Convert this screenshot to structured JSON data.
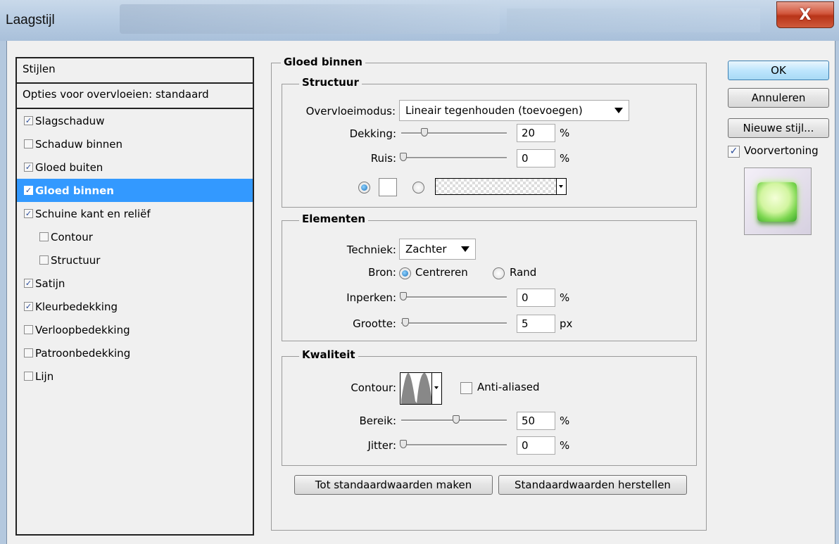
{
  "window": {
    "title": "Laagstijl",
    "close_glyph": "X"
  },
  "styles": {
    "header": "Stijlen",
    "blend_options": "Opties voor overvloeien: standaard",
    "items": [
      {
        "label": "Slagschaduw",
        "checked": true
      },
      {
        "label": "Schaduw binnen",
        "checked": false
      },
      {
        "label": "Gloed buiten",
        "checked": true
      },
      {
        "label": "Gloed binnen",
        "checked": true,
        "selected": true
      },
      {
        "label": "Schuine kant en reliëf",
        "checked": true
      },
      {
        "label": "Contour",
        "checked": false,
        "indent": true
      },
      {
        "label": "Structuur",
        "checked": false,
        "indent": true
      },
      {
        "label": "Satijn",
        "checked": true
      },
      {
        "label": "Kleurbedekking",
        "checked": true
      },
      {
        "label": "Verloopbedekking",
        "checked": false
      },
      {
        "label": "Patroonbedekking",
        "checked": false
      },
      {
        "label": "Lijn",
        "checked": false
      }
    ]
  },
  "panel": {
    "title": "Gloed binnen",
    "structure": {
      "title": "Structuur",
      "blend_mode_label": "Overvloeimodus:",
      "blend_mode_value": "Lineair tegenhouden (toevoegen)",
      "opacity_label": "Dekking:",
      "opacity_value": "20",
      "opacity_unit": "%",
      "opacity_fraction": 0.2,
      "noise_label": "Ruis:",
      "noise_value": "0",
      "noise_unit": "%",
      "noise_fraction": 0.0
    },
    "elements": {
      "title": "Elementen",
      "technique_label": "Techniek:",
      "technique_value": "Zachter",
      "source_label": "Bron:",
      "source_center": "Centreren",
      "source_edge": "Rand",
      "choke_label": "Inperken:",
      "choke_value": "0",
      "choke_unit": "%",
      "choke_fraction": 0.0,
      "size_label": "Grootte:",
      "size_value": "5",
      "size_unit": "px",
      "size_fraction": 0.02
    },
    "quality": {
      "title": "Kwaliteit",
      "contour_label": "Contour:",
      "antialias_label": "Anti-aliased",
      "range_label": "Bereik:",
      "range_value": "50",
      "range_unit": "%",
      "range_fraction": 0.5,
      "jitter_label": "Jitter:",
      "jitter_value": "0",
      "jitter_unit": "%",
      "jitter_fraction": 0.0
    },
    "make_default": "Tot standaardwaarden maken",
    "reset_default": "Standaardwaarden herstellen"
  },
  "actions": {
    "ok": "OK",
    "cancel": "Annuleren",
    "new_style": "Nieuwe stijl...",
    "preview_label": "Voorvertoning",
    "preview_checked": true
  }
}
